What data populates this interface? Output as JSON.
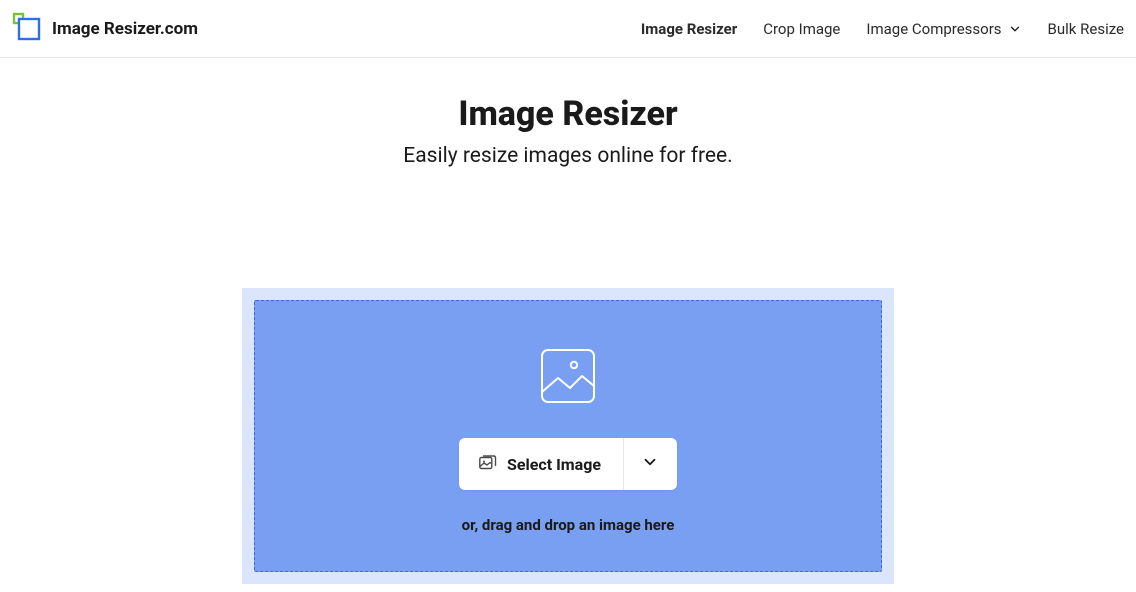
{
  "brand": {
    "name": "Image Resizer.com"
  },
  "nav": {
    "resizer": "Image Resizer",
    "crop": "Crop Image",
    "compressors": "Image Compressors",
    "bulk": "Bulk Resize"
  },
  "hero": {
    "title": "Image Resizer",
    "subtitle": "Easily resize images online for free."
  },
  "uploader": {
    "select_label": "Select Image",
    "drop_text": "or, drag and drop an image here"
  }
}
